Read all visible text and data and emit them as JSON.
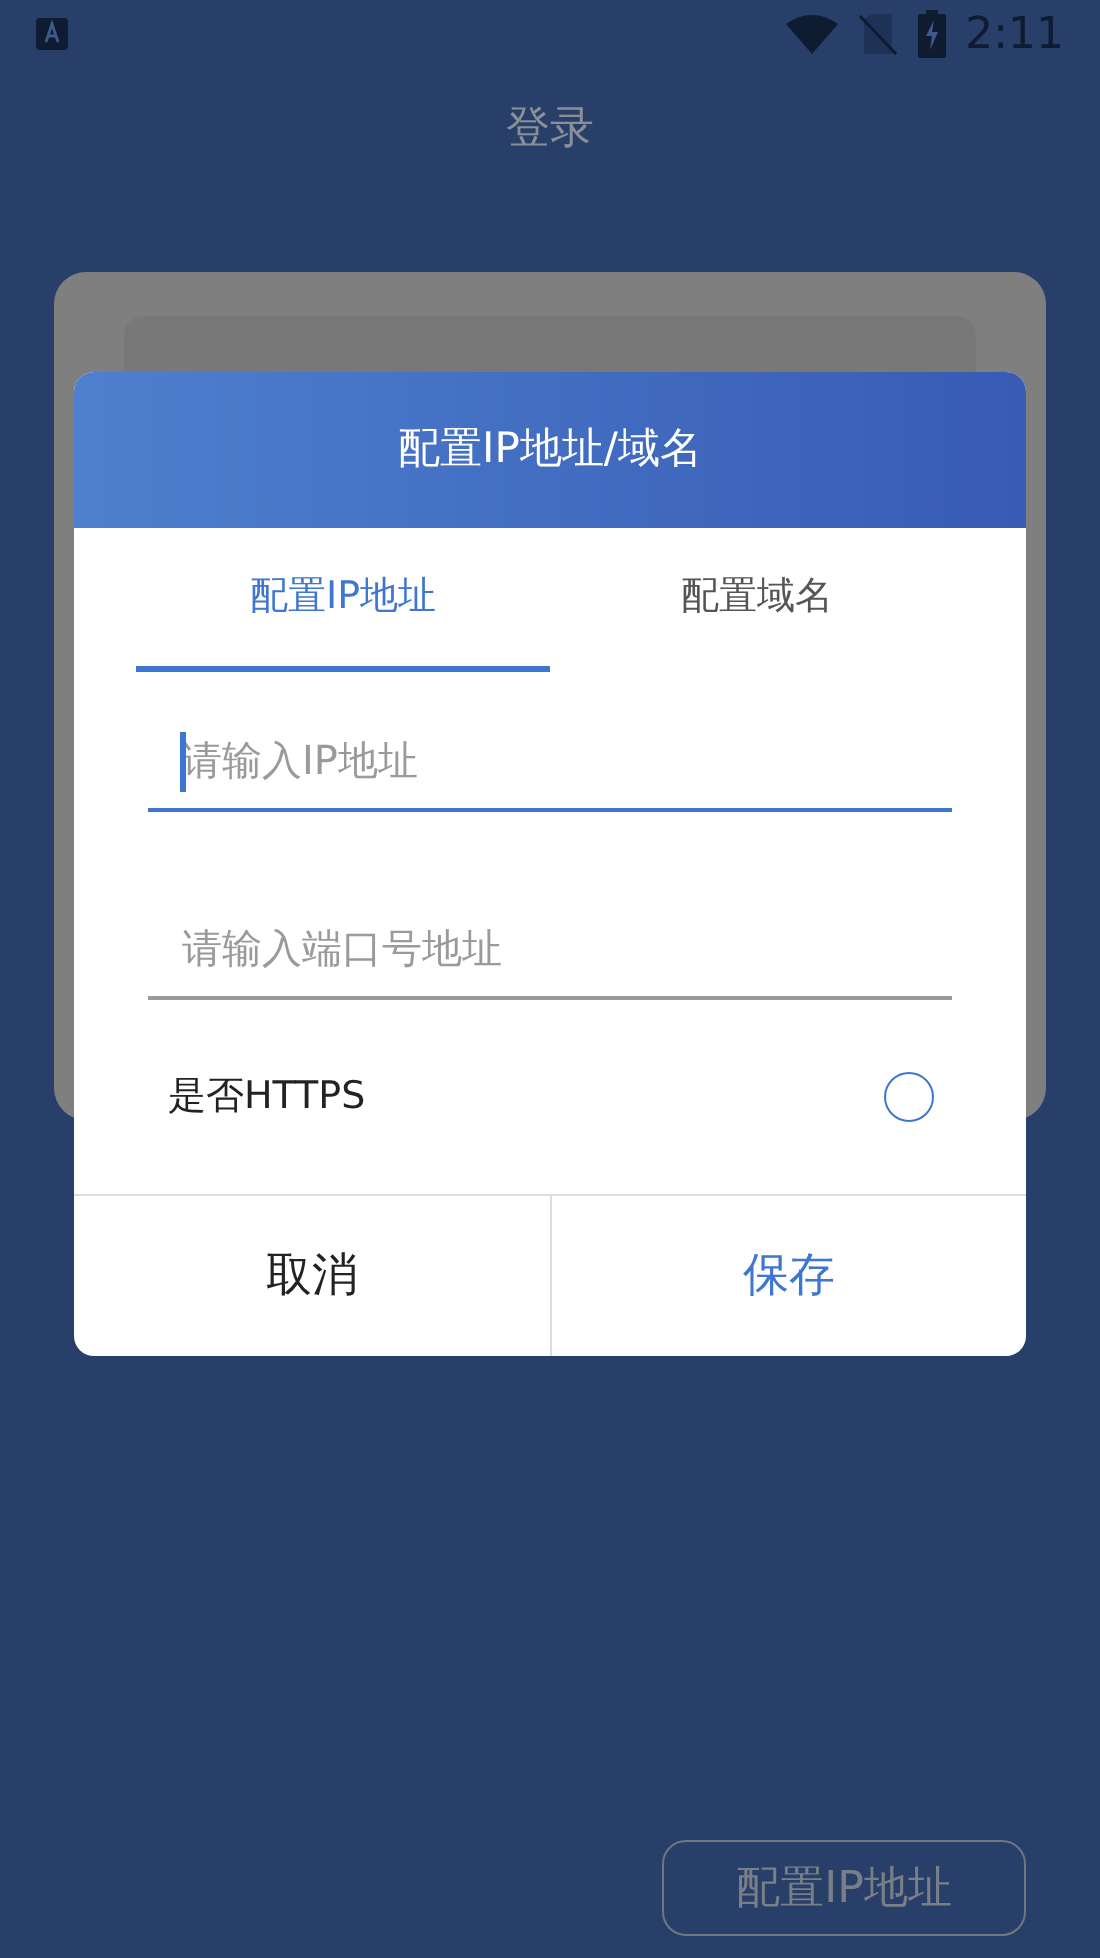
{
  "status_bar": {
    "time": "2:11"
  },
  "page_title": "登录",
  "dialog": {
    "title": "配置IP地址/域名",
    "tabs": [
      {
        "label": "配置IP地址",
        "selected": true
      },
      {
        "label": "配置域名",
        "selected": false
      }
    ],
    "fields": [
      {
        "placeholder": "请输入IP地址",
        "focused": true
      },
      {
        "placeholder": "请输入端口号地址",
        "focused": false
      }
    ],
    "https": {
      "label": "是否HTTPS",
      "checked": false
    },
    "buttons": [
      {
        "label": "取消",
        "kind": "cancel"
      },
      {
        "label": "保存",
        "kind": "save"
      }
    ]
  },
  "config_button": "配置IP地址"
}
